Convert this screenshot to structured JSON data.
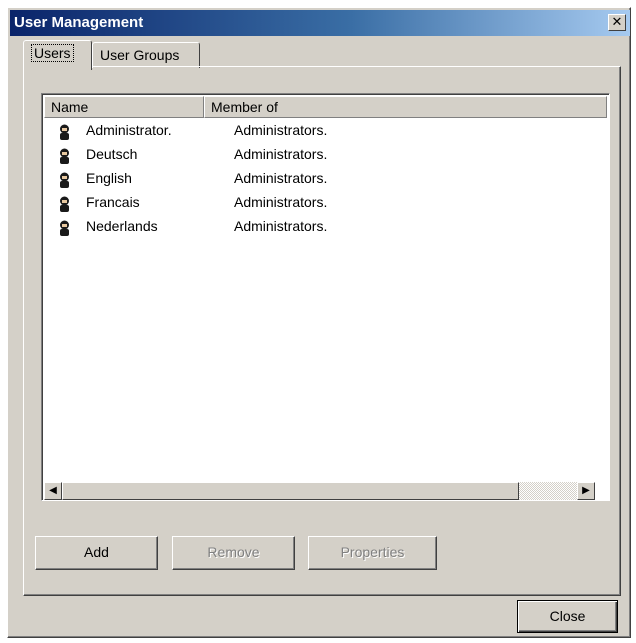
{
  "window": {
    "title": "User Management",
    "close_glyph": "✕"
  },
  "tabs": [
    {
      "label": "Users",
      "active": true
    },
    {
      "label": "User Groups",
      "active": false
    }
  ],
  "list": {
    "columns": [
      "Name",
      "Member of"
    ],
    "rows": [
      {
        "name": "Administrator.",
        "member_of": "Administrators.",
        "icon": "user-icon"
      },
      {
        "name": "Deutsch",
        "member_of": "Administrators.",
        "icon": "user-icon"
      },
      {
        "name": "English",
        "member_of": "Administrators.",
        "icon": "user-icon"
      },
      {
        "name": "Francais",
        "member_of": "Administrators.",
        "icon": "user-icon"
      },
      {
        "name": "Nederlands",
        "member_of": "Administrators.",
        "icon": "user-icon"
      }
    ]
  },
  "scrollbar": {
    "left_arrow": "◀",
    "right_arrow": "▶"
  },
  "buttons": {
    "add": {
      "label": "Add",
      "enabled": true
    },
    "remove": {
      "label": "Remove",
      "enabled": false
    },
    "properties": {
      "label": "Properties",
      "enabled": false
    },
    "close": {
      "label": "Close",
      "enabled": true
    }
  },
  "colors": {
    "title_gradient_start": "#0a246a",
    "title_gradient_end": "#a6caf0",
    "face": "#d4d0c8"
  }
}
